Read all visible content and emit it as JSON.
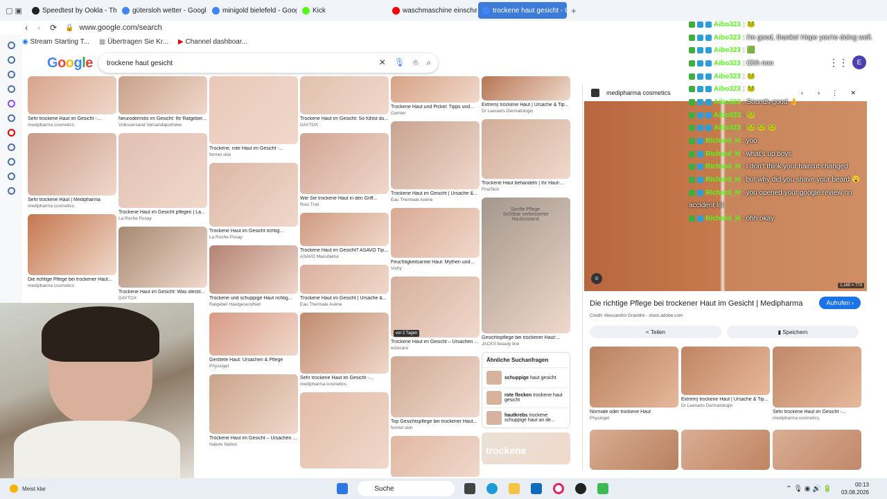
{
  "tabs": [
    {
      "label": "Speedtest by Ookla - The G",
      "color": "#222"
    },
    {
      "label": "gütersloh wetter - Google S",
      "color": "#4285f4"
    },
    {
      "label": "minigold bielefeld - Googl",
      "color": "#4285f4"
    },
    {
      "label": "Kick",
      "color": "#53fc18"
    },
    {
      "label": "waschmaschine einschalte",
      "color": "#ff0000"
    },
    {
      "label": "trockene haut gesicht - Go",
      "color": "#4285f4"
    }
  ],
  "address": "www.google.com/search",
  "bookmarks": [
    "Stream Starting T...",
    "Übertragen Sie Kr...",
    "Channel dashboar..."
  ],
  "google": {
    "logo": "Google",
    "query": "trockene haut gesicht",
    "avatar": "E"
  },
  "grid": {
    "columns": [
      [
        {
          "caption": "Sehr trockene Haut im Gesicht -...",
          "source": "medipharma cosmetics",
          "shade": "#d8a48c",
          "h": 55
        },
        {
          "caption": "Sehr trockene Haut | Medipharma",
          "source": "medipharma cosmetics",
          "shade": "#c89a88",
          "h": 90
        },
        {
          "caption": "Die richtige Pflege bei trockener Haut...",
          "source": "medipharma cosmetics",
          "shade": "#c4784f",
          "h": 88
        }
      ],
      [
        {
          "caption": "Neurodermitis im Gesicht: Ihr Ratgeber...",
          "source": "Volksversand Versandapotheke",
          "shade": "#c9a08a",
          "h": 55
        },
        {
          "caption": "Trockene Haut im Gesicht pflegen | La...",
          "source": "La Roche Posay",
          "shade": "#e2bfb3",
          "h": 108
        },
        {
          "caption": "Trockene Haut im Gesicht: Was steckt...",
          "source": "DAYTOX",
          "shade": "#a78972",
          "h": 88
        }
      ],
      [
        {
          "caption": "Trockene, rote Haut im Gesicht -...",
          "source": "formel skin",
          "shade": "#e9c8b8",
          "h": 98
        },
        {
          "caption": "Trockene Haut im Gesicht richtig...",
          "source": "La Roche Posay",
          "shade": "#dcb7a6",
          "h": 92
        },
        {
          "caption": "Trockene und schuppige Haut richtig...",
          "source": "Ratgeber Hautgesundheit",
          "shade": "#b38272",
          "h": 70
        },
        {
          "caption": "Gerötete Haut: Ursachen & Pflege",
          "source": "Physiogel",
          "shade": "#d89a86",
          "h": 62
        },
        {
          "caption": "Trockene Haut im Gesicht – Ursachen ...",
          "source": "Nature Nation",
          "shade": "#caa38b",
          "h": 86
        }
      ],
      [
        {
          "caption": "Trockene Haut im Gesicht: So fühlst du...",
          "source": "DAYTOX",
          "shade": "#e1c0ae",
          "h": 55
        },
        {
          "caption": "Wie Sie trockene Haut in den Griff...",
          "source": "Rosi Troll",
          "shade": "#d1a494",
          "h": 88
        },
        {
          "caption": "Trockene Haut im Gesicht? ASAVO Tipps",
          "source": "ASAVO Manufaktur",
          "shade": "#d09a80",
          "h": 48
        },
        {
          "caption": "Trockene Haut im Gesicht | Ursache &...",
          "source": "Eau Thermale Avène",
          "shade": "#dbb09e",
          "h": 42
        },
        {
          "caption": "Sehr trockene Haut im Gesicht -...",
          "source": "medipharma cosmetics",
          "shade": "#c08a6d",
          "h": 88
        },
        {
          "caption": "",
          "source": "",
          "shade": "#e2bca7",
          "h": 110
        }
      ],
      [
        {
          "caption": "Trockene Haut und Pickel: Tipps und...",
          "source": "Garnier",
          "shade": "#d6a283",
          "h": 38
        },
        {
          "caption": "Trockene Haut im Gesicht | Ursache &...",
          "source": "Eau Thermale Avène",
          "shade": "#c9a392",
          "h": 98
        },
        {
          "caption": "Feuchtigkeitsarme Haut: Mythen und...",
          "source": "Vichy",
          "shade": "#d9a994",
          "h": 72
        },
        {
          "caption": "Trockene Haut im Gesicht – Ursachen ...",
          "source": "ectocare",
          "shade": "#d6b09d",
          "h": 88
        },
        {
          "caption": "Top Gesichtspflege bei trockener Haut...",
          "source": "formel skin",
          "shade": "#d0aa96",
          "h": 88
        },
        {
          "caption": "",
          "source": "",
          "shade": "#e0b7a2",
          "h": 60
        }
      ],
      [
        {
          "caption": "Extrem) trockene Haut | Ursache & Tip...",
          "source": "Dr Leenarts Dermatologin",
          "shade": "#b67653",
          "h": 35
        },
        {
          "caption": "Trockene Haut behandeln | Ihr Haut-...",
          "source": "FineSkin",
          "shade": "#d1ac98",
          "h": 86
        },
        {
          "caption": "Gesichtspflege bei trockener Haut:...",
          "source": "JACKS beauty line",
          "shade": "#a4978c",
          "h": 196
        },
        {
          "caption": "",
          "source": "",
          "shade": "#e9e2d6",
          "h": 46
        }
      ]
    ],
    "badge": "vor 2 Tagen",
    "ad_text": [
      "Sanfte Pflege.",
      "Sichtbar verbesserter",
      "Hautzustand."
    ],
    "ad2_text": "trockene",
    "similar": {
      "title": "Ähnliche Suchanfragen",
      "items": [
        {
          "bold": "schuppige",
          "rest": " haut gesicht"
        },
        {
          "bold": "rote flecken",
          "rest": " trockene haut gesicht"
        },
        {
          "bold": "hautkrebs",
          "rest": " trockene schuppige haut an de..."
        }
      ]
    }
  },
  "panel": {
    "site": "medipharma cosmetics",
    "size": "1.160 × 773",
    "title": "Die richtige Pflege bei trockener Haut im Gesicht | Medipharma",
    "visit": "Aufrufen",
    "credit": "Credit: Alessandro Grandini - stock.adobe.com",
    "share": "Teilen",
    "save": "Speichern",
    "thumbs": [
      {
        "caption": "Normale oder trockene Haut",
        "source": "Physiogel",
        "shade": "#b8815f"
      },
      {
        "caption": "Extrem) trockene Haut | Ursache & Tip...",
        "source": "Dr Leenarts Dermatologin",
        "shade": "#c08462"
      },
      {
        "caption": "Sehr trockene Haut im Gesicht -...",
        "source": "medipharma cosmetics",
        "shade": "#c1886a"
      }
    ]
  },
  "chat": [
    {
      "user": "Aibo323",
      "msg": ":",
      "emote": "🐸"
    },
    {
      "user": "Aibo323",
      "msg": ": i'm good, thanks! Hope you're doing well.",
      "emote": ""
    },
    {
      "user": "Aibo323",
      "msg": ":",
      "emote": "🟩"
    },
    {
      "user": "Aibo323",
      "msg": ": Ohh noo",
      "emote": ""
    },
    {
      "user": "Aibo323",
      "msg": ":",
      "emote": "🐸"
    },
    {
      "user": "Aibo323",
      "msg": ":",
      "emote": "🐸"
    },
    {
      "user": "Aibo323",
      "msg": ": Sounds good",
      "emote": "👌"
    },
    {
      "user": "Aibo323",
      "msg": ":",
      "emote": "🐸"
    },
    {
      "user": "Aibo323",
      "msg": ":",
      "emote": "🐸 🐸 🐸"
    },
    {
      "user": "Richard_H",
      "msg": ": yoo",
      "emote": ""
    },
    {
      "user": "Richard_H",
      "msg": ": what's up boys",
      "emote": ""
    },
    {
      "user": "Richard_H",
      "msg": ": I don't think your haircut changed",
      "emote": ""
    },
    {
      "user": "Richard_H",
      "msg": ": but why did you shave your beard",
      "emote": "😮"
    },
    {
      "user": "Richard_H",
      "msg": ": you opened your google review on",
      "emote": ""
    },
    {
      "user": "",
      "msg": "accident lol",
      "emote": ""
    },
    {
      "user": "Richard_H",
      "msg": ": ohh okay",
      "emote": ""
    }
  ],
  "taskbar": {
    "search": "Suche",
    "weather": "Meist klar",
    "time": "00:13",
    "date": "03.08.2026"
  }
}
